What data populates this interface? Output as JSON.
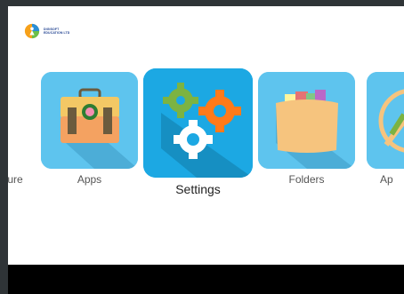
{
  "brand": {
    "name_line1": "DIGISOFT",
    "name_line2": "EDUCATION LTD"
  },
  "apps": [
    {
      "label": "ture",
      "icon": "picture-icon-partial",
      "focused": false
    },
    {
      "label": "Apps",
      "icon": "briefcase-icon",
      "focused": false
    },
    {
      "label": "Settings",
      "icon": "gears-icon",
      "focused": true
    },
    {
      "label": "Folders",
      "icon": "folder-icon",
      "focused": false
    },
    {
      "label": "Ap",
      "icon": "app-icon-partial",
      "focused": false
    }
  ],
  "colors": {
    "tile": "#5ec4ee",
    "tile_focused": "#1ca8e3",
    "gear_green": "#7cb342",
    "gear_orange": "#ff7a1a",
    "folder": "#f6c47e"
  }
}
